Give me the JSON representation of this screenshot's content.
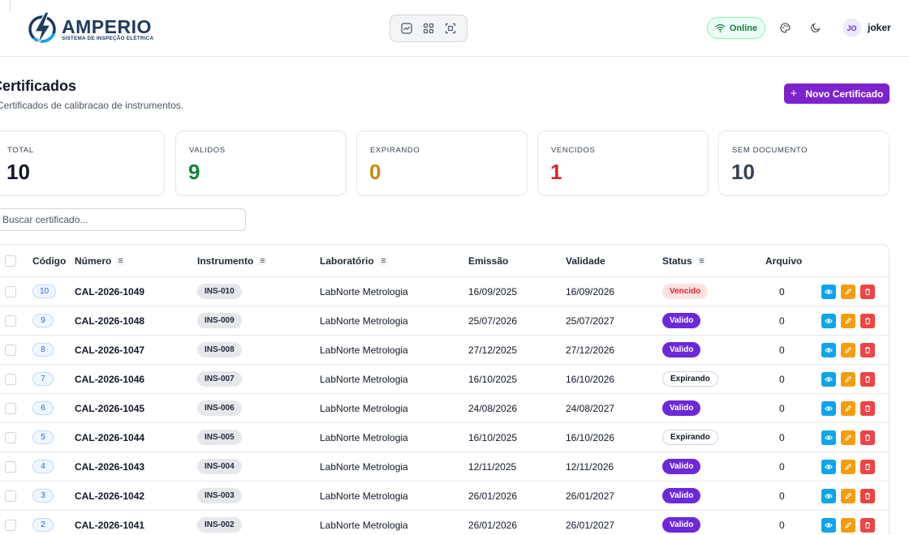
{
  "brand": {
    "name_main": "AMPER",
    "name_accent": "IO",
    "tagline": "SISTEMA DE INSPEÇÃO ELÉTRICA"
  },
  "header": {
    "status": "Online",
    "user_initials": "JO",
    "user_name": "joker"
  },
  "page": {
    "title": "Certificados",
    "subtitle": "Certificados de calibracao de instrumentos.",
    "new_button": "Novo Certificado"
  },
  "stats": [
    {
      "label": "TOTAL",
      "value": "10",
      "color": "#111827"
    },
    {
      "label": "VALIDOS",
      "value": "9",
      "color": "#15803d"
    },
    {
      "label": "EXPIRANDO",
      "value": "0",
      "color": "#ca8a04"
    },
    {
      "label": "VENCIDOS",
      "value": "1",
      "color": "#dc2626"
    },
    {
      "label": "SEM DOCUMENTO",
      "value": "10",
      "color": "#374151"
    }
  ],
  "search": {
    "placeholder": "Buscar certificado..."
  },
  "table": {
    "columns": {
      "codigo": "Código",
      "numero": "Número",
      "instrumento": "Instrumento",
      "laboratorio": "Laboratório",
      "emissao": "Emissão",
      "validade": "Validade",
      "status": "Status",
      "arquivo": "Arquivo"
    },
    "rows": [
      {
        "codigo": "10",
        "numero": "CAL-2026-1049",
        "instrumento": "INS-010",
        "laboratorio": "LabNorte Metrologia",
        "emissao": "16/09/2025",
        "validade": "16/09/2026",
        "status": "Vencido",
        "arquivo": "0"
      },
      {
        "codigo": "9",
        "numero": "CAL-2026-1048",
        "instrumento": "INS-009",
        "laboratorio": "LabNorte Metrologia",
        "emissao": "25/07/2026",
        "validade": "25/07/2027",
        "status": "Valido",
        "arquivo": "0"
      },
      {
        "codigo": "8",
        "numero": "CAL-2026-1047",
        "instrumento": "INS-008",
        "laboratorio": "LabNorte Metrologia",
        "emissao": "27/12/2025",
        "validade": "27/12/2026",
        "status": "Valido",
        "arquivo": "0"
      },
      {
        "codigo": "7",
        "numero": "CAL-2026-1046",
        "instrumento": "INS-007",
        "laboratorio": "LabNorte Metrologia",
        "emissao": "16/10/2025",
        "validade": "16/10/2026",
        "status": "Expirando",
        "arquivo": "0"
      },
      {
        "codigo": "6",
        "numero": "CAL-2026-1045",
        "instrumento": "INS-006",
        "laboratorio": "LabNorte Metrologia",
        "emissao": "24/08/2026",
        "validade": "24/08/2027",
        "status": "Valido",
        "arquivo": "0"
      },
      {
        "codigo": "5",
        "numero": "CAL-2026-1044",
        "instrumento": "INS-005",
        "laboratorio": "LabNorte Metrologia",
        "emissao": "16/10/2025",
        "validade": "16/10/2026",
        "status": "Expirando",
        "arquivo": "0"
      },
      {
        "codigo": "4",
        "numero": "CAL-2026-1043",
        "instrumento": "INS-004",
        "laboratorio": "LabNorte Metrologia",
        "emissao": "12/11/2025",
        "validade": "12/11/2026",
        "status": "Valido",
        "arquivo": "0"
      },
      {
        "codigo": "3",
        "numero": "CAL-2026-1042",
        "instrumento": "INS-003",
        "laboratorio": "LabNorte Metrologia",
        "emissao": "26/01/2026",
        "validade": "26/01/2027",
        "status": "Valido",
        "arquivo": "0"
      },
      {
        "codigo": "2",
        "numero": "CAL-2026-1041",
        "instrumento": "INS-002",
        "laboratorio": "LabNorte Metrologia",
        "emissao": "26/01/2026",
        "validade": "26/01/2027",
        "status": "Valido",
        "arquivo": "0"
      }
    ]
  },
  "icons": {
    "view_mode_chart": "chart-icon",
    "view_mode_grid": "grid-icon",
    "view_mode_focus": "focus-icon",
    "online": "wifi-icon",
    "theme_palette": "palette-icon",
    "dark_mode": "moon-icon",
    "row_view": "eye-icon",
    "row_edit": "pencil-icon",
    "row_delete": "trash-icon"
  },
  "colors": {
    "accent": "#7e22ce",
    "valido": "#6d28d9",
    "vencido": "#dc2626",
    "online": "#15803d"
  }
}
